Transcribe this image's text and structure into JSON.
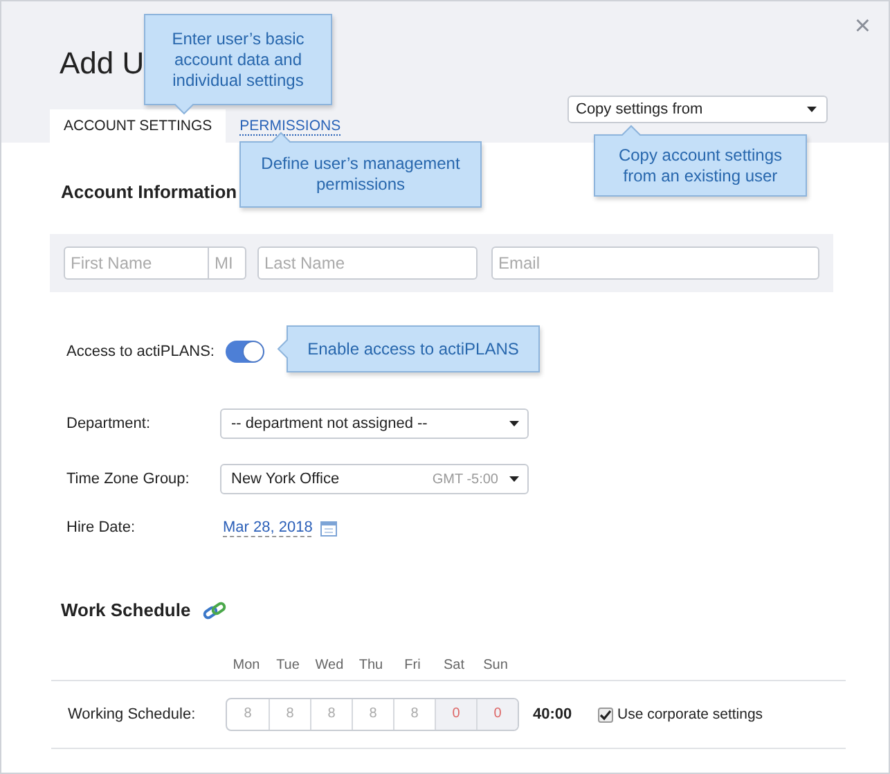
{
  "dialog": {
    "title": "Add U",
    "close": "×"
  },
  "tabs": [
    {
      "label": "ACCOUNT SETTINGS",
      "selected": true
    },
    {
      "label": "PERMISSIONS",
      "selected": false
    }
  ],
  "copy_settings": {
    "placeholder": "Copy settings from"
  },
  "account_information": {
    "heading": "Account Information",
    "fields": [
      {
        "placeholder": "First Name"
      },
      {
        "placeholder": "MI"
      },
      {
        "placeholder": "Last Name"
      },
      {
        "placeholder": "Email"
      }
    ]
  },
  "access": {
    "label": "Access to actiPLANS:",
    "on": true
  },
  "department": {
    "label": "Department:",
    "value": "-- department not assigned --"
  },
  "time_zone_group": {
    "label": "Time Zone Group:",
    "value": "New York Office",
    "offset": "GMT -5:00"
  },
  "hire_date": {
    "label": "Hire Date:",
    "value": "Mar 28, 2018"
  },
  "work_schedule": {
    "heading": "Work Schedule",
    "row_label": "Working Schedule:",
    "total": "40:00",
    "days": [
      {
        "day": "Mon",
        "hours": "8",
        "weekend": false
      },
      {
        "day": "Tue",
        "hours": "8",
        "weekend": false
      },
      {
        "day": "Wed",
        "hours": "8",
        "weekend": false
      },
      {
        "day": "Thu",
        "hours": "8",
        "weekend": false
      },
      {
        "day": "Fri",
        "hours": "8",
        "weekend": false
      },
      {
        "day": "Sat",
        "hours": "0",
        "weekend": true
      },
      {
        "day": "Sun",
        "hours": "0",
        "weekend": true
      }
    ],
    "corporate": {
      "label": "Use corporate settings",
      "checked": true
    }
  },
  "tooltips": [
    {
      "text": "Enter user’s basic account data and individual settings"
    },
    {
      "text": "Define user’s management permissions"
    },
    {
      "text": "Copy account settings from an existing user"
    },
    {
      "text": "Enable access to actiPLANS"
    }
  ]
}
